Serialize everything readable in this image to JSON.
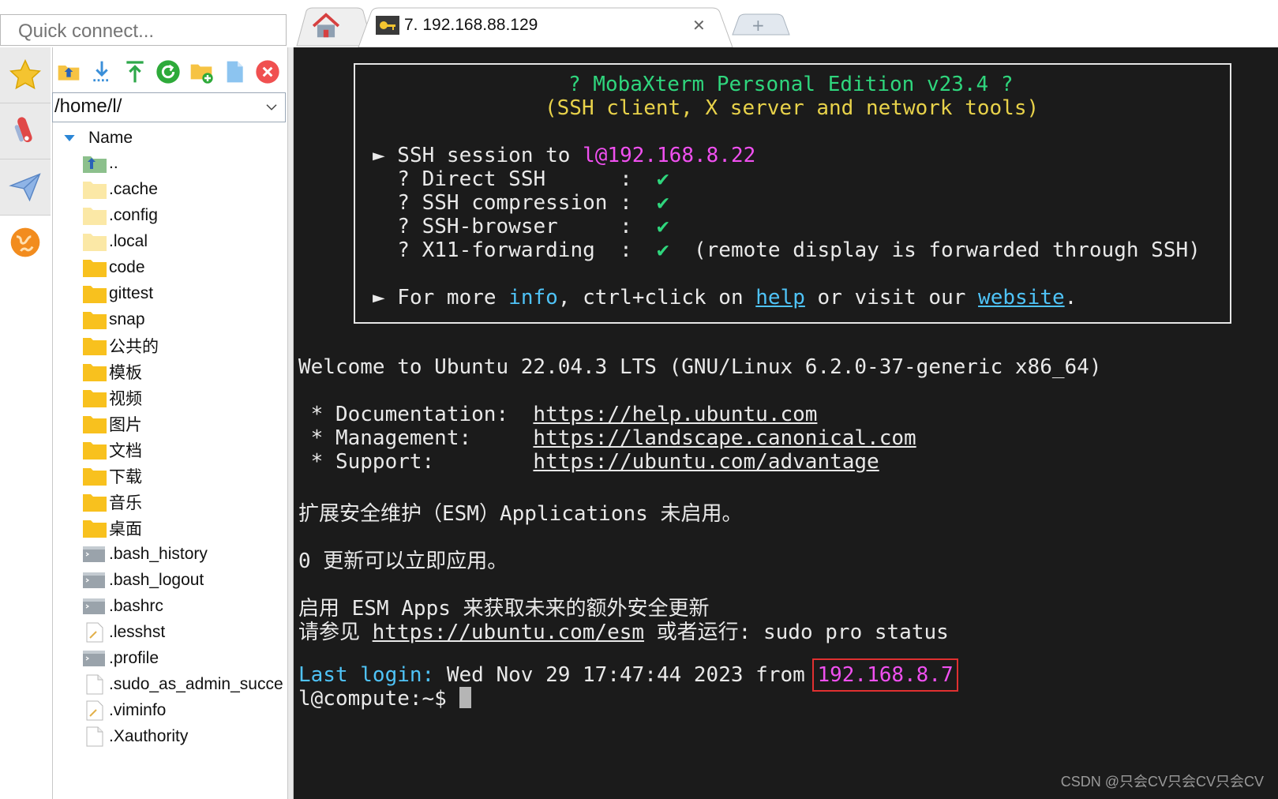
{
  "quick_connect": {
    "placeholder": "Quick connect..."
  },
  "sidebar": {
    "tabs": [
      {
        "icon": "star-icon"
      },
      {
        "icon": "tools-icon"
      },
      {
        "icon": "paper-plane-icon"
      },
      {
        "icon": "globe-icon"
      }
    ],
    "toolbar": [
      "parent-folder-icon",
      "download-icon",
      "upload-icon",
      "refresh-icon",
      "new-folder-icon",
      "new-file-icon",
      "delete-icon"
    ],
    "path": "/home/l/",
    "column_header": "Name",
    "files": [
      {
        "name": "..",
        "type": "parent"
      },
      {
        "name": ".cache",
        "type": "folder-hidden"
      },
      {
        "name": ".config",
        "type": "folder-hidden"
      },
      {
        "name": ".local",
        "type": "folder-hidden"
      },
      {
        "name": "code",
        "type": "folder"
      },
      {
        "name": "gittest",
        "type": "folder"
      },
      {
        "name": "snap",
        "type": "folder"
      },
      {
        "name": "公共的",
        "type": "folder"
      },
      {
        "name": "模板",
        "type": "folder"
      },
      {
        "name": "视频",
        "type": "folder"
      },
      {
        "name": "图片",
        "type": "folder"
      },
      {
        "name": "文档",
        "type": "folder"
      },
      {
        "name": "下载",
        "type": "folder"
      },
      {
        "name": "音乐",
        "type": "folder"
      },
      {
        "name": "桌面",
        "type": "folder"
      },
      {
        "name": ".bash_history",
        "type": "shell"
      },
      {
        "name": ".bash_logout",
        "type": "shell"
      },
      {
        "name": ".bashrc",
        "type": "shell"
      },
      {
        "name": ".lesshst",
        "type": "text"
      },
      {
        "name": ".profile",
        "type": "shell"
      },
      {
        "name": ".sudo_as_admin_succe",
        "type": "file"
      },
      {
        "name": ".viminfo",
        "type": "text"
      },
      {
        "name": ".Xauthority",
        "type": "file"
      }
    ]
  },
  "tabs": {
    "home_icon": "home-icon",
    "session_title": "7. 192.168.88.129",
    "close_glyph": "✕",
    "new_tab_glyph": "+"
  },
  "terminal": {
    "banner": {
      "title": "? MobaXterm Personal Edition v23.4 ?",
      "subtitle": "(SSH client, X server and network tools)",
      "session_prefix": "► SSH session to ",
      "session_target": "l@192.168.8.22",
      "rows": [
        {
          "label": "  ? Direct SSH      :  ",
          "check": "✔",
          "note": ""
        },
        {
          "label": "  ? SSH compression :  ",
          "check": "✔",
          "note": ""
        },
        {
          "label": "  ? SSH-browser     :  ",
          "check": "✔",
          "note": ""
        },
        {
          "label": "  ? X11-forwarding  :  ",
          "check": "✔",
          "note": "  (remote display is forwarded through SSH)"
        }
      ],
      "more_prefix": "► For more ",
      "more_info": "info",
      "more_mid": ", ctrl+click on ",
      "more_help": "help",
      "more_mid2": " or visit our ",
      "more_website": "website",
      "more_end": "."
    },
    "welcome": "Welcome to Ubuntu 22.04.3 LTS (GNU/Linux 6.2.0-37-generic x86_64)",
    "links": [
      {
        "label": " * Documentation:  ",
        "url": "https://help.ubuntu.com"
      },
      {
        "label": " * Management:     ",
        "url": "https://landscape.canonical.com"
      },
      {
        "label": " * Support:        ",
        "url": "https://ubuntu.com/advantage"
      }
    ],
    "esm_line": "扩展安全维护（ESM）Applications 未启用。",
    "updates_line": "0 更新可以立即应用。",
    "enable_line": "启用 ESM Apps 来获取未来的额外安全更新",
    "see_prefix": "请参见 ",
    "see_url": "https://ubuntu.com/esm",
    "see_suffix": " 或者运行: sudo pro status",
    "last_login_label": "Last login:",
    "last_login_text": " Wed Nov 29 17:47:44 2023 from ",
    "last_login_ip": "192.168.8.7",
    "prompt": "l@compute:~$ "
  },
  "watermark": "CSDN @只会CV只会CV只会CV",
  "colors": {
    "terminal_bg": "#1b1b1b",
    "highlight_box": "#e03030",
    "banner_green": "#2fd67d",
    "banner_yellow": "#e8d24a",
    "magenta": "#f050f0",
    "cyan": "#4fc3f7"
  }
}
